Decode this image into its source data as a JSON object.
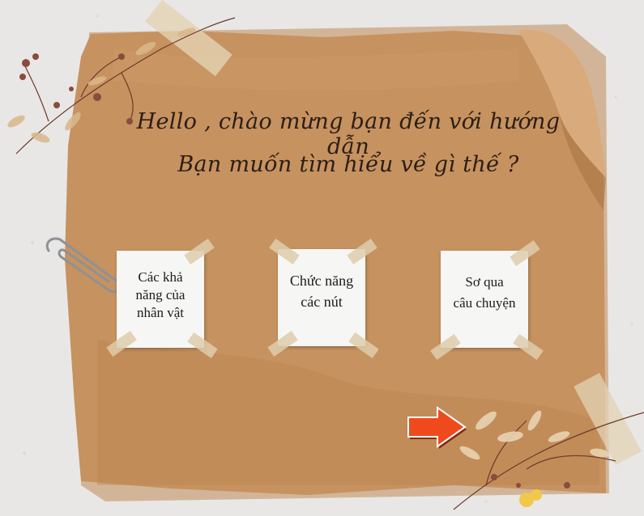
{
  "greeting": {
    "line1": "Hello , chào mừng bạn đến với hướng dẫn",
    "line2": "Bạn muốn tìm hiểu về gì thế ?"
  },
  "notes": [
    {
      "label_lines": [
        "Các khả",
        "năng của",
        "nhân vật"
      ]
    },
    {
      "label_lines": [
        "Chức năng",
        "các nút"
      ]
    },
    {
      "label_lines": [
        "Sơ qua",
        "câu chuyện"
      ]
    }
  ],
  "colors": {
    "kraft_paper": "#c6925f",
    "note_paper": "#f6f6f5",
    "arrow": "#ee4a1e",
    "text": "#2b1e16"
  },
  "icons": {
    "next": "right-arrow-icon",
    "clip": "paperclip-icon"
  }
}
